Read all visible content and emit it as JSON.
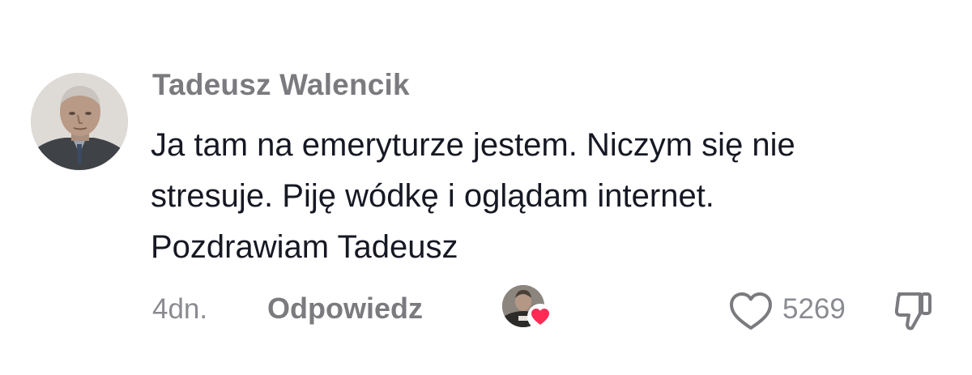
{
  "comment": {
    "author": "Tadeusz Walencik",
    "text_lines": [
      "Ja tam na emeryturze jestem. Niczym się nie",
      "stresuje. Piję wódkę i oglądam internet.",
      "Pozdrawiam Tadeusz"
    ],
    "date": "4dn.",
    "reply_label": "Odpowiedz",
    "like_count": "5269"
  },
  "icons": {
    "avatar": "user-avatar-photo",
    "creator_like": "creator-liked-heart-icon",
    "like": "heart-outline-icon",
    "dislike": "thumbs-down-icon"
  },
  "colors": {
    "author": "#7b7b7f",
    "text": "#161823",
    "meta": "#8a8b91",
    "heart_accent": "#fe2c55"
  }
}
